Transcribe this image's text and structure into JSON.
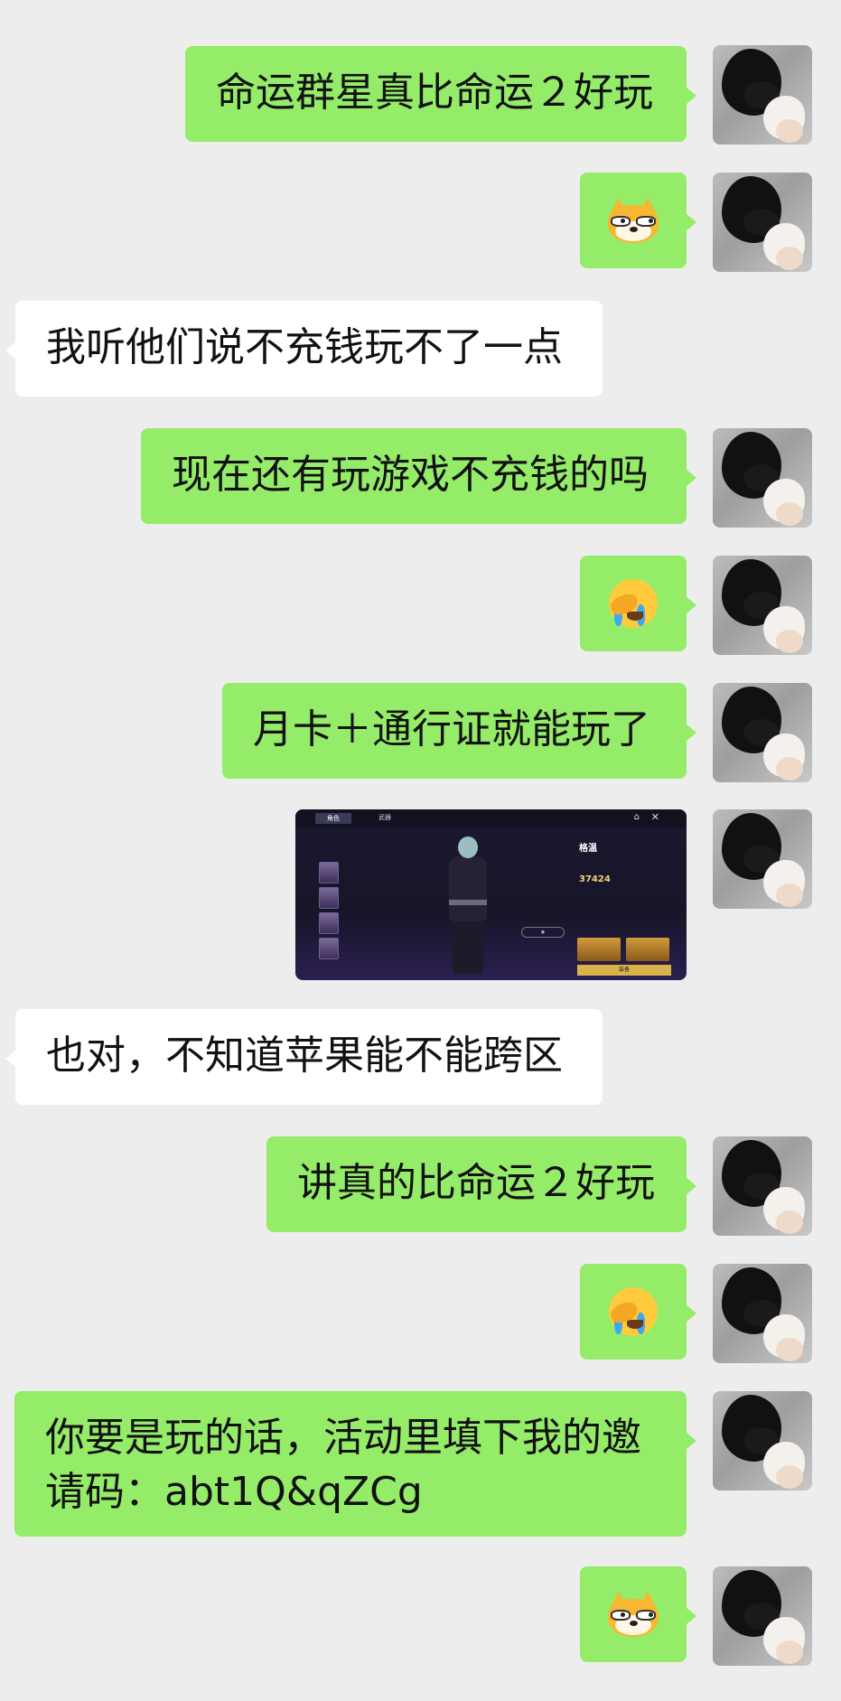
{
  "messages": [
    {
      "side": "sent",
      "type": "text",
      "text": "命运群星真比命运２好玩"
    },
    {
      "side": "sent",
      "type": "emoji",
      "emoji": "doge-emoji"
    },
    {
      "side": "received",
      "type": "text",
      "text": "我听他们说不充钱玩不了一点"
    },
    {
      "side": "sent",
      "type": "text",
      "text": "现在还有玩游戏不充钱的吗"
    },
    {
      "side": "sent",
      "type": "emoji",
      "emoji": "facepalm-cry-emoji"
    },
    {
      "side": "sent",
      "type": "text",
      "text": "月卡＋通行证就能玩了"
    },
    {
      "side": "sent",
      "type": "image",
      "image": "game-character-screenshot"
    },
    {
      "side": "received",
      "type": "text",
      "text": "也对，不知道苹果能不能跨区"
    },
    {
      "side": "sent",
      "type": "text",
      "text": "讲真的比命运２好玩"
    },
    {
      "side": "sent",
      "type": "emoji",
      "emoji": "facepalm-cry-emoji"
    },
    {
      "side": "sent",
      "type": "text",
      "text": "你要是玩的话，活动里填下我的邀\n请码：abt1Q&qZCg"
    },
    {
      "side": "sent",
      "type": "emoji",
      "emoji": "doge-emoji"
    }
  ],
  "game_screenshot": {
    "tabs": [
      "角色",
      "武器"
    ],
    "character_name": "格温",
    "power": "37424",
    "equip_label": "装备"
  },
  "colors": {
    "background": "#ededed",
    "sent_bubble": "#95ec69",
    "received_bubble": "#ffffff"
  }
}
